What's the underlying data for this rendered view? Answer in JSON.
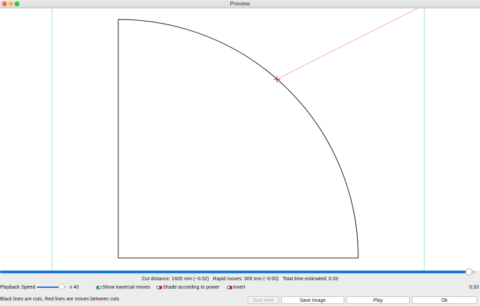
{
  "window": {
    "title": "Preview"
  },
  "preview": {
    "playback_fraction": 0.985,
    "colors": {
      "cut": "#222222",
      "rapid": "#f4a0a8",
      "boundary": "#9be8a8",
      "head": "#e02020"
    }
  },
  "stats": {
    "cut_distance": "Cut distance: 1605 mm (~0:32)",
    "rapid_moves": "Rapid moves: 309 mm (~0:00)",
    "total_time": "Total time estimated: 0:33"
  },
  "controls": {
    "speed_label": "Playback Speed",
    "speed_value": "x 40",
    "speed_fraction": 0.85,
    "show_traversal": {
      "label": "Show traversal moves",
      "checked": true
    },
    "shade_power": {
      "label": "Shade according to power",
      "checked": false
    },
    "invert": {
      "label": "Invert",
      "checked": false
    },
    "elapsed": "0:33",
    "legend": "Black lines are cuts, Red lines are moves between cuts"
  },
  "buttons": {
    "start_here": "Start here",
    "save_image": "Save Image",
    "play": "Play",
    "ok": "Ok"
  }
}
